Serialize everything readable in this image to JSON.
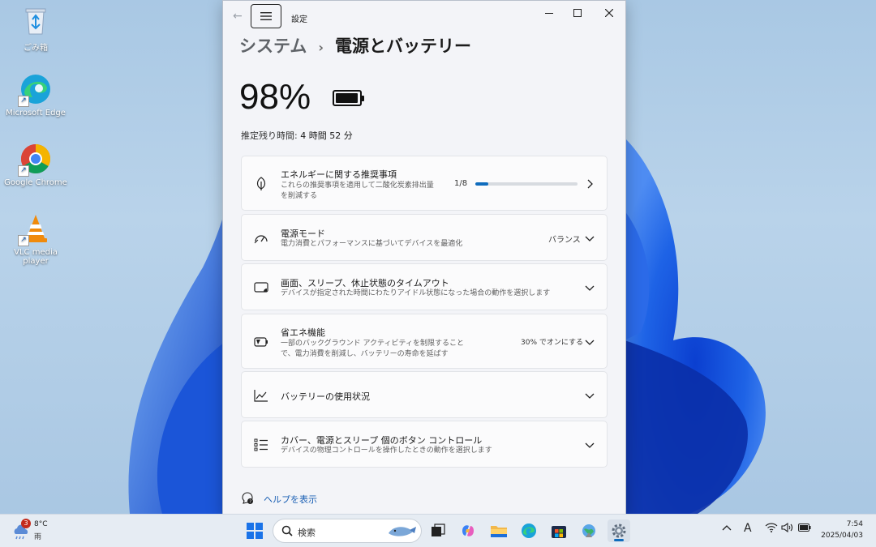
{
  "desktop": {
    "icons": [
      {
        "label": "ごみ箱",
        "icon": "recycle-bin-icon"
      },
      {
        "label": "Microsoft Edge",
        "icon": "edge-icon"
      },
      {
        "label": "Google Chrome",
        "icon": "chrome-icon"
      },
      {
        "label": "VLC media player",
        "icon": "vlc-icon"
      }
    ]
  },
  "window": {
    "title": "設定",
    "breadcrumb": {
      "parent": "システム",
      "separator": "›",
      "current": "電源とバッテリー"
    },
    "battery": {
      "percent_text": "98%",
      "level_percent": 98
    },
    "estimate": {
      "label": "推定残り時間:",
      "value": "4 時間 52 分"
    },
    "cards": [
      {
        "title": "エネルギーに関する推奨事項",
        "subtitle": "これらの推奨事項を適用して二酸化炭素排出量を削減する",
        "value": "1/8",
        "progress": 0.125,
        "icon": "leaf-icon",
        "chevron": "chevron-right-icon"
      },
      {
        "title": "電源モード",
        "subtitle": "電力消費とパフォーマンスに基づいてデバイスを最適化",
        "value": "バランス",
        "icon": "power-mode-icon",
        "chevron": "chevron-down-icon"
      },
      {
        "title": "画面、スリープ、休止状態のタイムアウト",
        "subtitle": "デバイスが指定された時間にわたりアイドル状態になった場合の動作を選択します",
        "value": "",
        "icon": "screen-sleep-icon",
        "chevron": "chevron-down-icon"
      },
      {
        "title": "省エネ機能",
        "subtitle": "一部のバックグラウンド アクティビティを制限することで、電力消費を削減し、バッテリーの寿命を延ばす",
        "value": "30% でオンにする",
        "icon": "battery-saver-icon",
        "chevron": "chevron-down-icon"
      },
      {
        "title": "バッテリーの使用状況",
        "subtitle": "",
        "value": "",
        "icon": "chart-line-icon",
        "chevron": "chevron-down-icon"
      },
      {
        "title": "カバー、電源とスリープ 個のボタン コントロール",
        "subtitle": "デバイスの物理コントロールを操作したときの動作を選択します",
        "value": "",
        "icon": "list-icon",
        "chevron": "chevron-down-icon"
      }
    ],
    "help": "ヘルプを表示"
  },
  "taskbar": {
    "weather": {
      "temp": "8°C",
      "condition": "雨",
      "badge": "3"
    },
    "search_placeholder": "検索",
    "tray": {
      "ime": "A"
    },
    "clock": {
      "time": "7:54",
      "date": "2025/04/03"
    }
  }
}
